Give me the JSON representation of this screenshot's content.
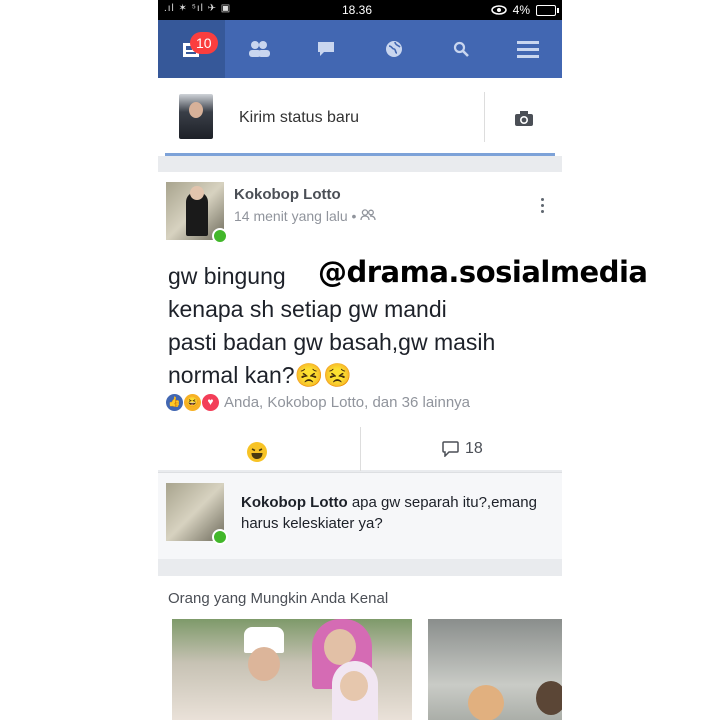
{
  "status_bar": {
    "left_icons": ".ıl ✶ ⁵ıl ✈ ▣",
    "time": "18.36",
    "battery": "4%"
  },
  "navbar": {
    "notification_count": "10"
  },
  "composer": {
    "placeholder": "Kirim status baru"
  },
  "post": {
    "author": "Kokobop Lotto",
    "time": "14 menit yang lalu",
    "body_lines": [
      "gw bingung",
      "kenapa sh setiap gw mandi",
      "pasti badan gw basah,gw masih",
      "normal kan?😣😣"
    ],
    "reactions_text": "Anda, Kokobop Lotto, dan 36 lainnya",
    "comment_count": "18"
  },
  "comment": {
    "author": "Kokobop Lotto",
    "text": "apa gw separah itu?,emang harus keleskiater ya?"
  },
  "suggestions": {
    "title": "Orang yang Mungkin Anda Kenal"
  },
  "watermark": "@drama.sosialmedia",
  "colors": {
    "nav_bg": "#4267b2",
    "nav_active": "#365899",
    "badge": "#fa3e3e",
    "online": "#42b72a"
  }
}
